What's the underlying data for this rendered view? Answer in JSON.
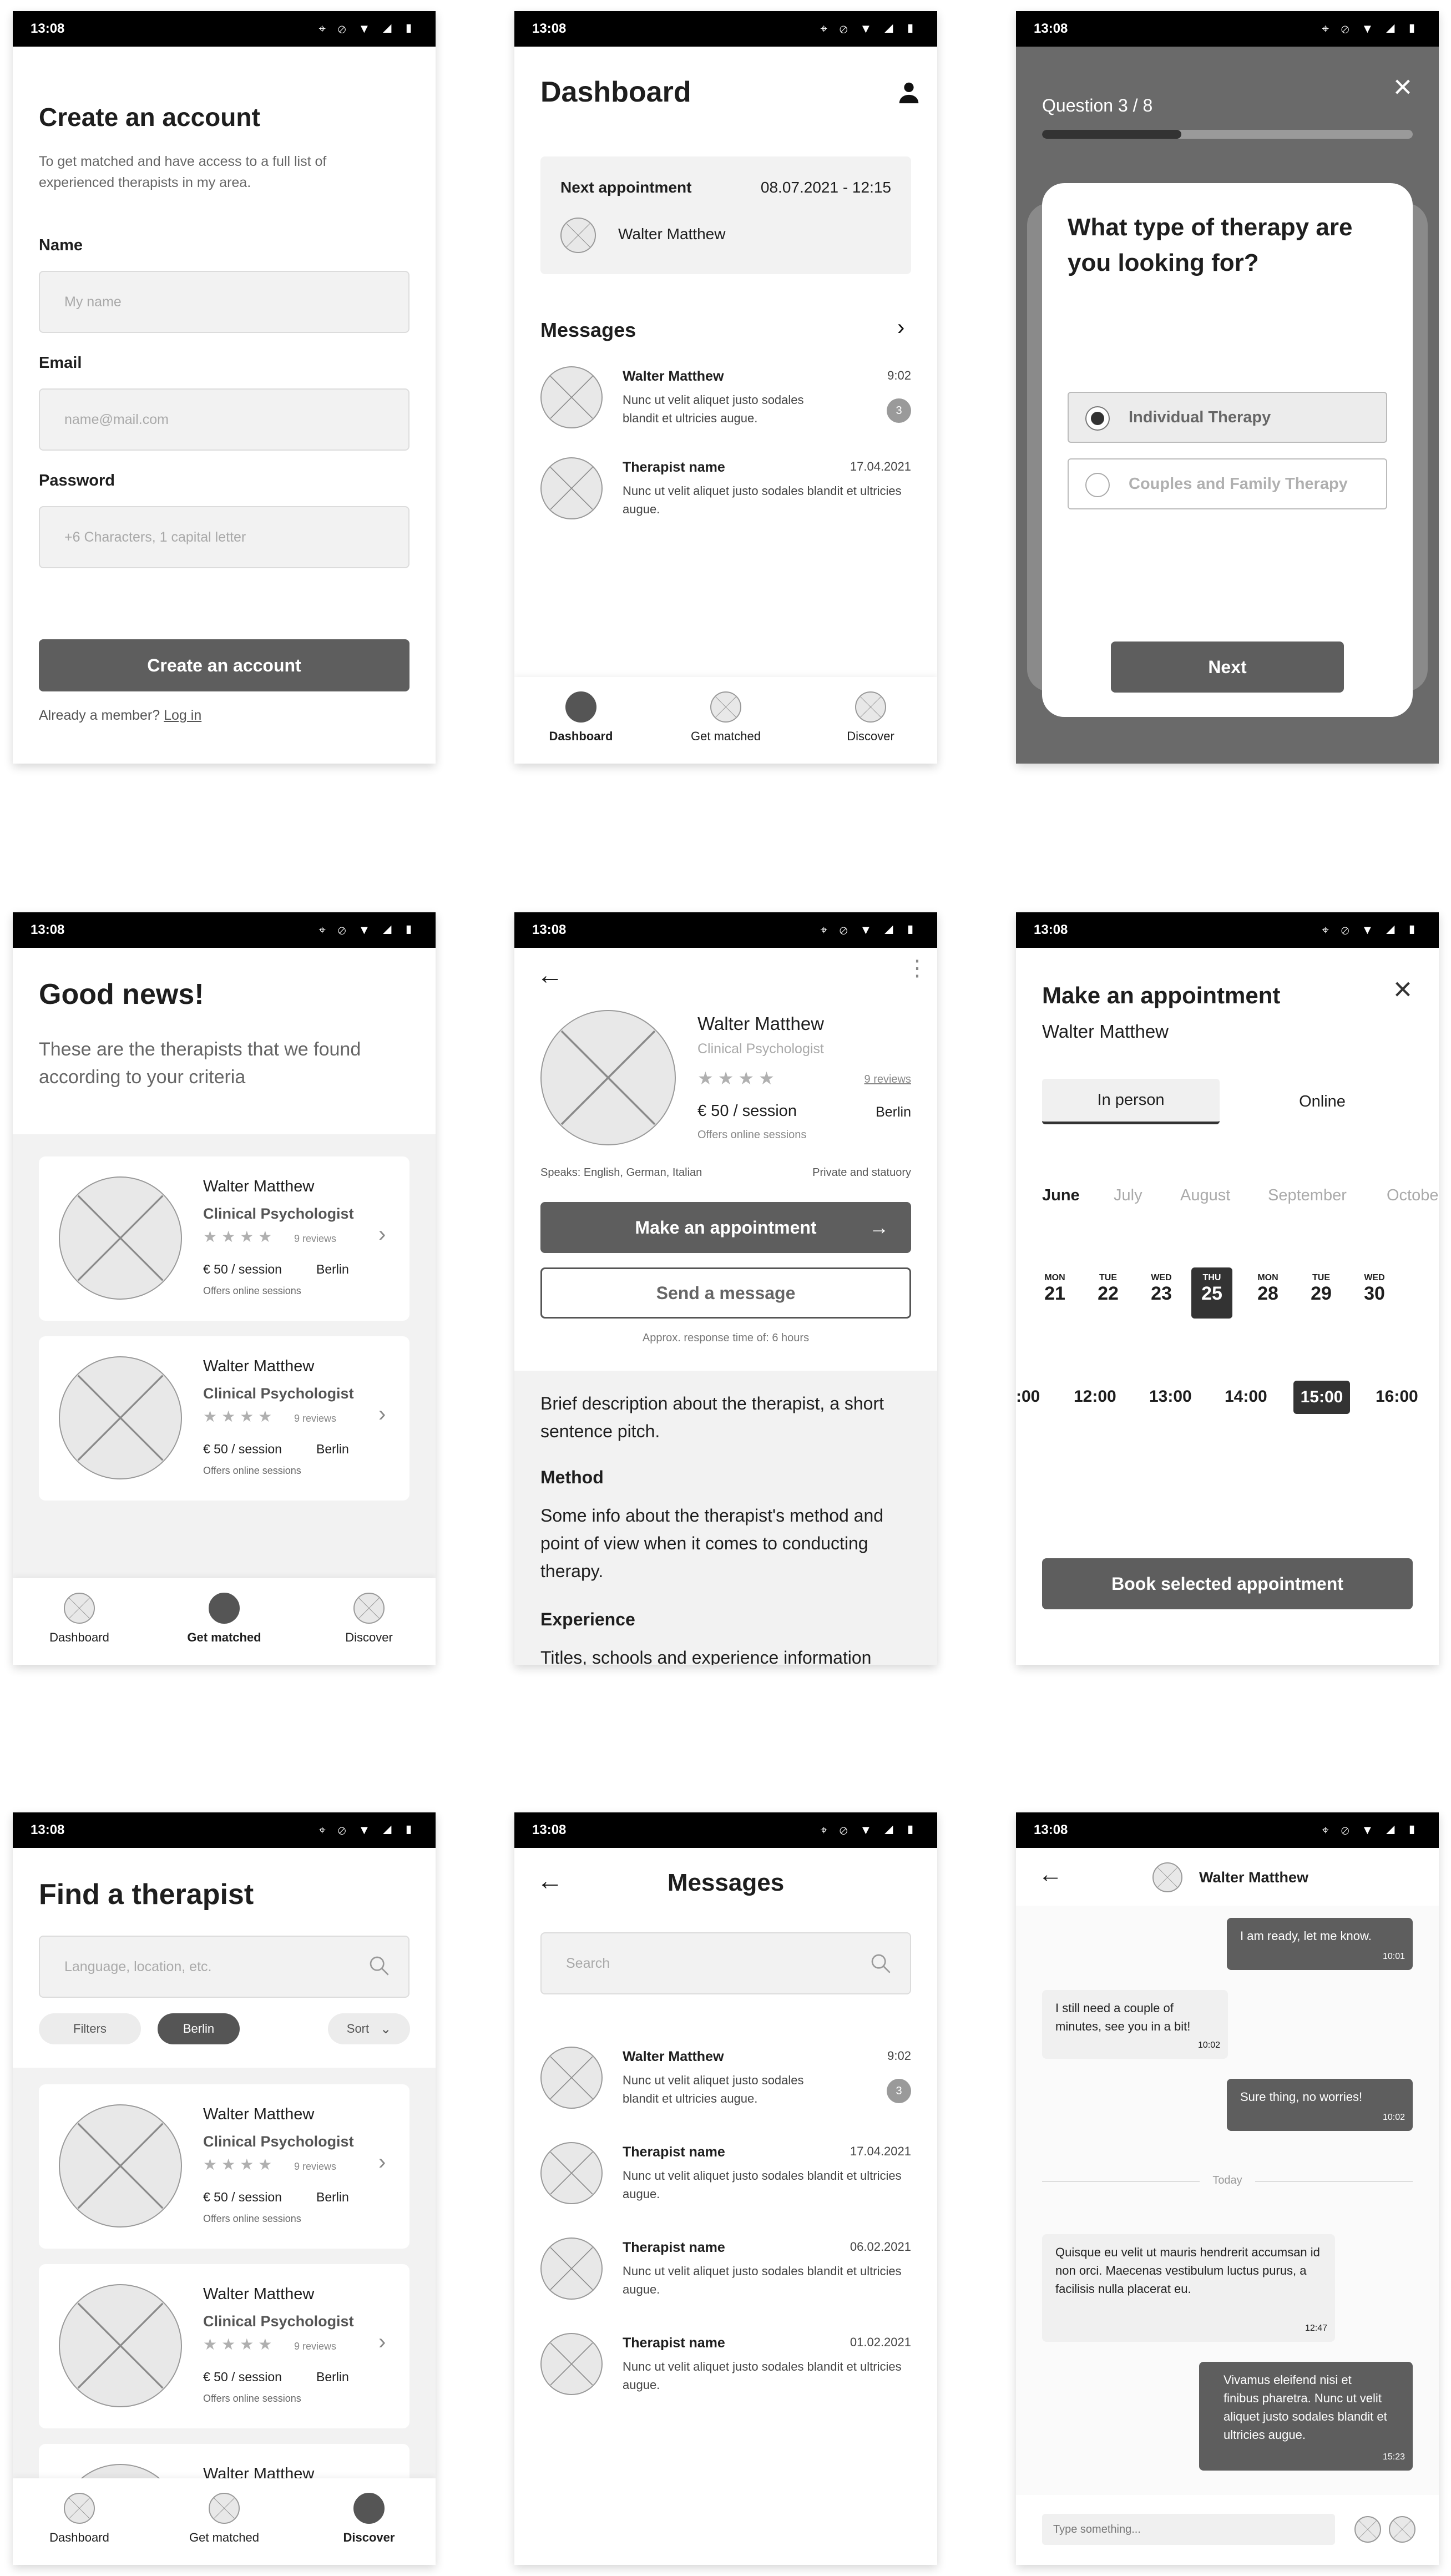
{
  "status": {
    "time": "13:08",
    "icons": "⌖ ⊘ ▼ ◢ ▮"
  },
  "signup": {
    "title": "Create an account",
    "subtitle": "To get matched and have access to a full list of experienced therapists in my area.",
    "name_label": "Name",
    "name_placeholder": "My name",
    "email_label": "Email",
    "email_placeholder": "name@mail.com",
    "password_label": "Password",
    "password_placeholder": "+6 Characters, 1 capital letter",
    "submit": "Create an account",
    "member_text": "Already a member?",
    "login_link": "Log in"
  },
  "dashboard": {
    "title": "Dashboard",
    "next_label": "Next appointment",
    "next_date": "08.07.2021 - 12:15",
    "next_name": "Walter Matthew",
    "messages_title": "Messages",
    "messages": [
      {
        "name": "Walter Matthew",
        "time": "9:02",
        "text": "Nunc ut velit aliquet justo sodales blandit et ultricies augue.",
        "badge": "3"
      },
      {
        "name": "Therapist name",
        "time": "17.04.2021",
        "text": "Nunc ut velit aliquet justo sodales blandit et ultricies augue."
      }
    ]
  },
  "tabs": [
    "Dashboard",
    "Get matched",
    "Discover"
  ],
  "question": {
    "counter": "Question 3 / 8",
    "progress": 0.375,
    "title": "What type of therapy are you looking for?",
    "options": [
      "Individual Therapy",
      "Couples and Family Therapy"
    ],
    "next": "Next"
  },
  "matches": {
    "title": "Good news!",
    "subtitle": "These are the therapists that we found according to your criteria"
  },
  "therapist": {
    "name": "Walter Matthew",
    "role": "Clinical Psychologist",
    "reviews": "9 reviews",
    "price": "€ 50 / session",
    "city": "Berlin",
    "online": "Offers online sessions",
    "rating": 4
  },
  "profile": {
    "name": "Walter Matthew",
    "role": "Clinical Psychologist",
    "reviews": "9 reviews",
    "price": "€ 50 / session",
    "city": "Berlin",
    "online": "Offers online sessions",
    "speaks": "Speaks: English, German, Italian",
    "insurance": "Private and statuory",
    "appointment_btn": "Make an appointment",
    "message_btn": "Send a message",
    "response": "Approx. response time of: 6 hours",
    "pitch": "Brief description about the therapist, a short sentence pitch.",
    "method_title": "Method",
    "method_text": "Some info about the therapist's method and point of view when it comes to conducting therapy.",
    "experience_title": "Experience",
    "experience_text": "Titles, schools and experience information"
  },
  "booking": {
    "title": "Make an appointment",
    "name": "Walter Matthew",
    "modes": [
      "In person",
      "Online"
    ],
    "months": [
      "June",
      "July",
      "August",
      "September",
      "Octobe"
    ],
    "days": [
      {
        "dow": "MON",
        "num": "21"
      },
      {
        "dow": "TUE",
        "num": "22"
      },
      {
        "dow": "WED",
        "num": "23"
      },
      {
        "dow": "THU",
        "num": "25"
      },
      {
        "dow": "MON",
        "num": "28"
      },
      {
        "dow": "TUE",
        "num": "29"
      },
      {
        "dow": "WED",
        "num": "30"
      }
    ],
    "times": [
      ":00",
      "12:00",
      "13:00",
      "14:00",
      "15:00",
      "16:00"
    ],
    "book": "Book selected appointment"
  },
  "find": {
    "title": "Find a therapist",
    "search_placeholder": "Language, location, etc.",
    "filter": "Filters",
    "chip": "Berlin",
    "sort": "Sort"
  },
  "inbox": {
    "title": "Messages",
    "search_placeholder": "Search",
    "items": [
      {
        "name": "Walter Matthew",
        "time": "9:02",
        "text": "Nunc ut velit aliquet justo sodales blandit et ultricies augue.",
        "badge": "3"
      },
      {
        "name": "Therapist name",
        "time": "17.04.2021",
        "text": "Nunc ut velit aliquet justo sodales blandit et ultricies augue."
      },
      {
        "name": "Therapist name",
        "time": "06.02.2021",
        "text": "Nunc ut velit aliquet justo sodales blandit et ultricies augue."
      },
      {
        "name": "Therapist name",
        "time": "01.02.2021",
        "text": "Nunc ut velit aliquet justo sodales blandit et ultricies augue."
      }
    ]
  },
  "chat": {
    "name": "Walter Matthew",
    "messages": [
      {
        "text": "I am ready, let me know.",
        "time": "10:01"
      },
      {
        "text": "I still need a couple of minutes, see you in a bit!",
        "time": "10:02"
      },
      {
        "text": "Sure thing, no worries!",
        "time": "10:02"
      },
      {
        "text": "Quisque eu velit ut mauris hendrerit accumsan id non orci. Maecenas vestibulum luctus purus, a facilisis nulla placerat eu.",
        "time": "12:47"
      },
      {
        "text": "Vivamus eleifend nisi et finibus pharetra. Nunc ut velit aliquet justo sodales blandit et ultricies augue.",
        "time": "15:23"
      }
    ],
    "divider": "Today",
    "input_placeholder": "Type something..."
  },
  "colors": {
    "accent": "#5e5e5e",
    "dark": "#1a1a1a",
    "surface": "#f2f2f2"
  }
}
